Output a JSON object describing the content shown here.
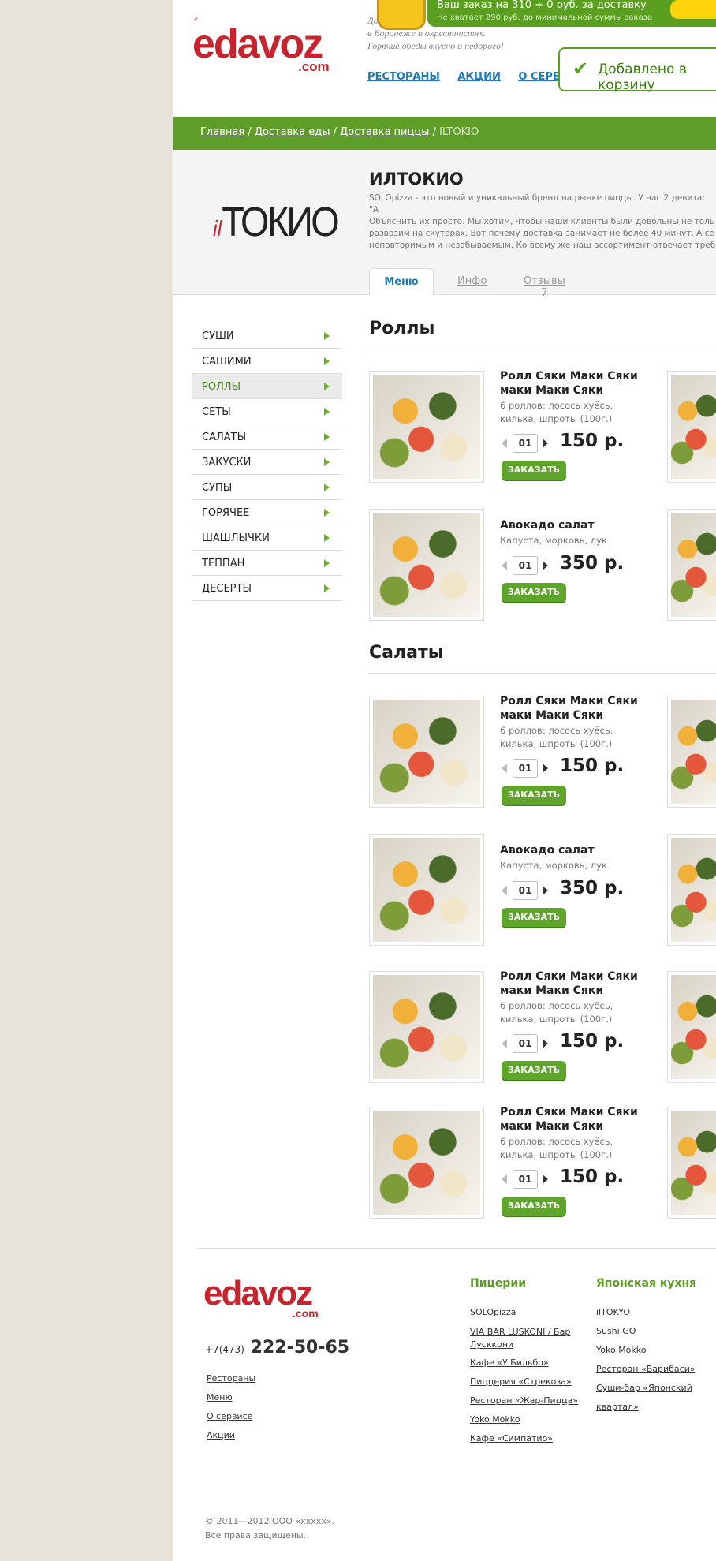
{
  "site": {
    "logo_main": "edavoz",
    "logo_com": ".com",
    "logo_accent": "´",
    "tagline": "Доставка еды\nв Воронеже и окрестностях.\nГорячие обеды вкусно и недорого!"
  },
  "topnav": {
    "items": [
      "РЕСТОРАНЫ",
      "АКЦИИ",
      "О СЕРВИСЕ"
    ]
  },
  "cart": {
    "line1": "Ваш заказ на 310 + 0 руб. за доставку",
    "line2": "Не хватает 290 руб. до минимальной суммы заказа",
    "added": "Добавлено в корзину"
  },
  "breadcrumbs": {
    "home": "Главная",
    "food": "Доставка еды",
    "pizza": "Доставка пиццы",
    "current": "ILTOKIO",
    "sep": " / "
  },
  "restaurant": {
    "logo_il": "il",
    "logo_main": "ТОКИО",
    "name": "ИЛТОКИО",
    "description": "SOLOpizza - это новый и уникальный бренд на рынке пиццы. У нас 2 девиза: \"А\nОбъяснить их просто. Мы хотим, чтобы наши клиенты были довольны не толь\nразвозим на скутерах. Вот почему доставка занимает не более 40 минут. А се\nнеповторимым и незабываемым. Ко всему же наш ассортимент отвечает треб\nпиццы. Да что говорить?.. Чтобы понять, надо попробовать! Заказывайте соло"
  },
  "tabs": {
    "menu": "Меню",
    "info": "Инфо",
    "reviews": "Отзывы 7"
  },
  "sidebar": {
    "items": [
      "СУШИ",
      "САШИМИ",
      "РОЛЛЫ",
      "СЕТЫ",
      "САЛАТЫ",
      "ЗАКУСКИ",
      "СУПЫ",
      "ГОРЯЧЕЕ",
      "ШАШЛЫЧКИ",
      "ТЕППАН",
      "ДЕСЕРТЫ"
    ]
  },
  "sections": [
    {
      "title": "Роллы",
      "products": [
        {
          "name": "Ролл Сяки Маки Сяки маки Маки Сяки",
          "desc": "6 роллов: лосось хуёсь, килька, шпроты (100г.)",
          "qty": "01",
          "price": "150 р.",
          "button": "ЗАКАЗАТЬ"
        },
        {
          "name": "Авокадо салат",
          "desc": "Капуста, морковь, лук",
          "qty": "01",
          "price": "350 р.",
          "button": "ЗАКАЗАТЬ"
        }
      ]
    },
    {
      "title": "Салаты",
      "products": [
        {
          "name": "Ролл Сяки Маки Сяки маки Маки Сяки",
          "desc": "6 роллов: лосось хуёсь, килька, шпроты (100г.)",
          "qty": "01",
          "price": "150 р.",
          "button": "ЗАКАЗАТЬ"
        },
        {
          "name": "Авокадо салат",
          "desc": "Капуста, морковь, лук",
          "qty": "01",
          "price": "350 р.",
          "button": "ЗАКАЗАТЬ"
        },
        {
          "name": "Ролл Сяки Маки Сяки маки Маки Сяки",
          "desc": "6 роллов: лосось хуёсь, килька, шпроты (100г.)",
          "qty": "01",
          "price": "150 р.",
          "button": "ЗАКАЗАТЬ"
        },
        {
          "name": "Ролл Сяки Маки Сяки маки Маки Сяки",
          "desc": "6 роллов: лосось хуёсь, килька, шпроты (100г.)",
          "qty": "01",
          "price": "150 р.",
          "button": "ЗАКАЗАТЬ"
        }
      ]
    }
  ],
  "footer": {
    "phone_prefix": "+7(473)",
    "phone": "222-50-65",
    "links": [
      "Рестораны",
      "Меню",
      "О сервисе",
      "Акции"
    ],
    "pizza_title": "Пицерии",
    "pizza_links": [
      "SOLOpizza",
      "VIA BAR LUSKONI / Бар Лусккони",
      "Кафе «У Бильбо»",
      "Пиццерия «Стрекоза»",
      "Ресторан «Жар-Пицца»",
      "Yoko Mokko",
      "Кафе «Симпатио»"
    ],
    "japan_title": "Японская кухня",
    "japan_links": [
      "ilTOKYO",
      "Sushi GO",
      "Yoko Mokko",
      "Ресторан «Варибаси»",
      "Суши-бар «Японский",
      "квартал»"
    ],
    "copy1": "© 2011—2012 ООО «xxxxx».",
    "copy2": "Все права защищены."
  },
  "colors": {
    "brand_red": "#c8242d",
    "green": "#5e9e28",
    "link_blue": "#1f7ab8"
  }
}
